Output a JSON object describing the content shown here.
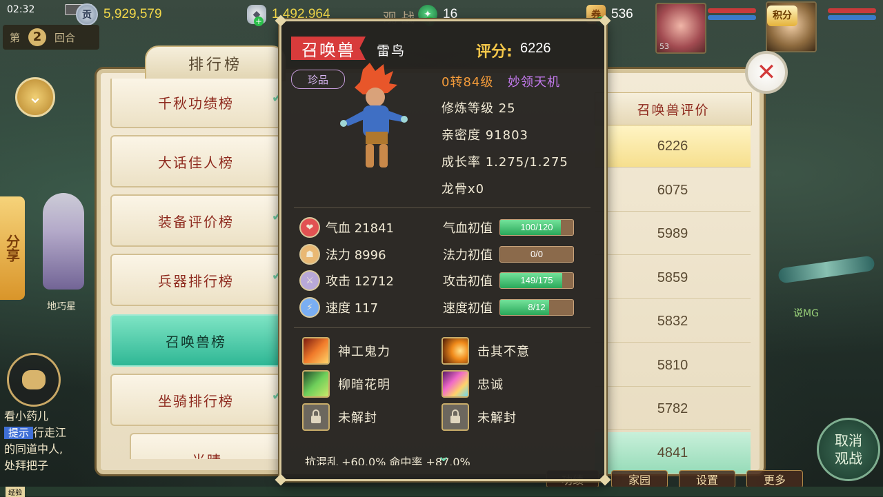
{
  "hud": {
    "time": "02:32",
    "currency_gong": "5,929,579",
    "currency_silver": "1,492,964",
    "currency_jade": "16",
    "currency_ticket": "536",
    "watch_text": "观战中",
    "round_prefix": "第",
    "round_number": "2",
    "round_suffix": "回合",
    "portrait1_level": "53",
    "jifen": "积分",
    "share": "分享",
    "npc_name": "地巧星",
    "right_label": "说MG",
    "cancel_watch": [
      "取消",
      "观战"
    ]
  },
  "chat": {
    "line1": "看小药儿",
    "tip": "提示",
    "line2": "行走江",
    "line3": "的同道中人,",
    "line4": "处拜把子"
  },
  "bottom_menu": [
    "功绩",
    "家园",
    "设置",
    "更多"
  ],
  "exp_label": "经验",
  "ranking": {
    "title": "排行榜",
    "categories": [
      {
        "label": "千秋功绩榜"
      },
      {
        "label": "大话佳人榜"
      },
      {
        "label": "装备评价榜"
      },
      {
        "label": "兵器排行榜"
      },
      {
        "label": "召唤兽榜"
      },
      {
        "label": "坐骑排行榜"
      },
      {
        "label": "光晴"
      }
    ],
    "active_index": 4,
    "column_header": "召唤兽评价",
    "scores": [
      "6226",
      "6075",
      "5989",
      "5859",
      "5832",
      "5810",
      "5782",
      "4841"
    ]
  },
  "pet": {
    "tag": "召唤兽",
    "name": "雷鸟",
    "score_label": "评分:",
    "score": "6226",
    "rarity": "珍品",
    "level": "0转84级",
    "school": "妙领天机",
    "cultivation": "修炼等级 25",
    "intimacy": "亲密度 91803",
    "growth": "成长率 1.275/1.275",
    "dragon_bone": "龙骨x0",
    "stats": [
      {
        "label": "气血 21841",
        "icon": "heart-icon",
        "color": "#e25252"
      },
      {
        "label": "法力 8996",
        "icon": "mana-icon",
        "color": "#e9b873"
      },
      {
        "label": "攻击 12712",
        "icon": "sword-icon",
        "color": "#b8a8d8"
      },
      {
        "label": "速度 117",
        "icon": "lightning-icon",
        "color": "#7aaef2"
      }
    ],
    "aptitudes": [
      {
        "label": "气血初值",
        "text": "100/120",
        "ratio": 0.833
      },
      {
        "label": "法力初值",
        "text": "0/0",
        "ratio": 0
      },
      {
        "label": "攻击初值",
        "text": "149/175",
        "ratio": 0.851
      },
      {
        "label": "速度初值",
        "text": "8/12",
        "ratio": 0.667
      }
    ],
    "skills": [
      {
        "name": "神工鬼力",
        "icon": "flame-fist-icon",
        "locked": false
      },
      {
        "name": "击其不意",
        "icon": "slash-arc-icon",
        "locked": false
      },
      {
        "name": "柳暗花明",
        "icon": "willow-icon",
        "locked": false
      },
      {
        "name": "忠诚",
        "icon": "rainbow-slash-icon",
        "locked": false
      },
      {
        "name": "未解封",
        "icon": "lock-icon",
        "locked": true
      },
      {
        "name": "未解封",
        "icon": "lock-icon",
        "locked": true
      }
    ],
    "bottom_text": "抗混乱      +60.0%  命中率      +87.0%"
  }
}
